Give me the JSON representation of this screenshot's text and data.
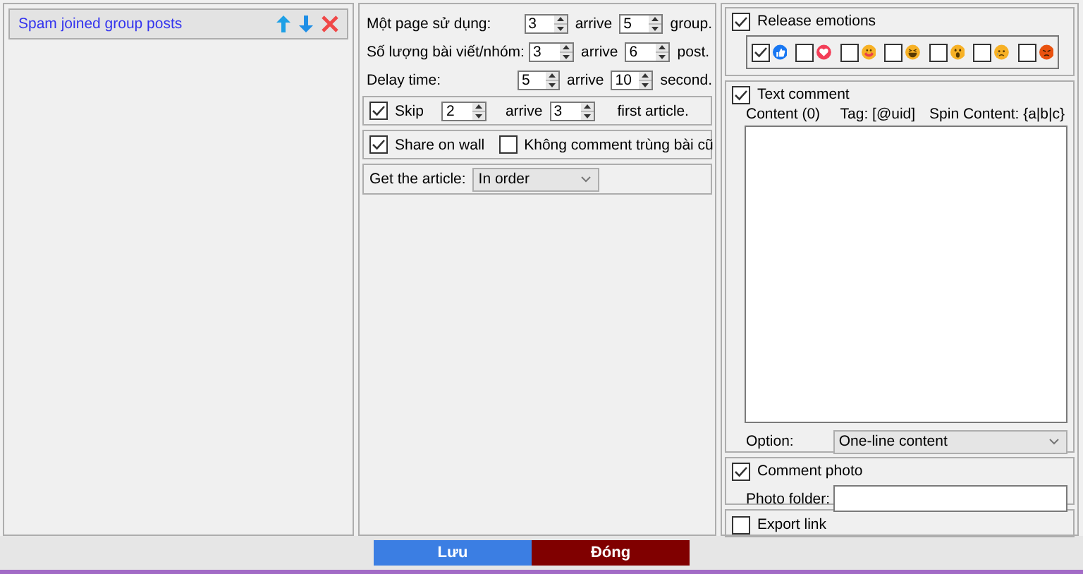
{
  "task_list": {
    "items": [
      {
        "label": "Spam joined group posts",
        "selected": true
      }
    ]
  },
  "ranges": [
    {
      "label": "Một page sử dụng:",
      "from": "3",
      "joiner": "arrive",
      "to": "5",
      "unit": "group."
    },
    {
      "label": "Số lượng bài viết/nhóm:",
      "from": "3",
      "joiner": "arrive",
      "to": "6",
      "unit": "post."
    },
    {
      "label": "Delay time:",
      "from": "5",
      "joiner": "arrive",
      "to": "10",
      "unit": "second."
    }
  ],
  "skip": {
    "checked": true,
    "label": "Skip",
    "from": "2",
    "joiner": "arrive",
    "to": "3",
    "unit": "first article."
  },
  "share_options": [
    {
      "checked": true,
      "label": "Share on wall"
    },
    {
      "checked": false,
      "label": "Không comment trùng bài cũ"
    }
  ],
  "get_article": {
    "label": "Get the article:",
    "value": "In order"
  },
  "release_emotions": {
    "checked": true,
    "label": "Release emotions",
    "emotions": [
      {
        "kind": "like",
        "checked": true
      },
      {
        "kind": "love",
        "checked": false
      },
      {
        "kind": "care",
        "checked": false
      },
      {
        "kind": "haha",
        "checked": false
      },
      {
        "kind": "wow",
        "checked": false
      },
      {
        "kind": "sad",
        "checked": false
      },
      {
        "kind": "angry",
        "checked": false
      }
    ]
  },
  "text_comment": {
    "checked": true,
    "label": "Text comment",
    "content_label": "Content (0)",
    "tag": "Tag: [@uid]",
    "spin": "Spin Content: {a|b|c}",
    "option_label": "Option:",
    "option_value": "One-line content"
  },
  "comment_photo": {
    "checked": true,
    "label": "Comment photo",
    "folder_label": "Photo folder:"
  },
  "export_link": {
    "checked": false,
    "label": "Export link"
  },
  "buttons": [
    {
      "label": "Lưu",
      "kind": "save"
    },
    {
      "label": "Đóng",
      "kind": "close"
    }
  ]
}
